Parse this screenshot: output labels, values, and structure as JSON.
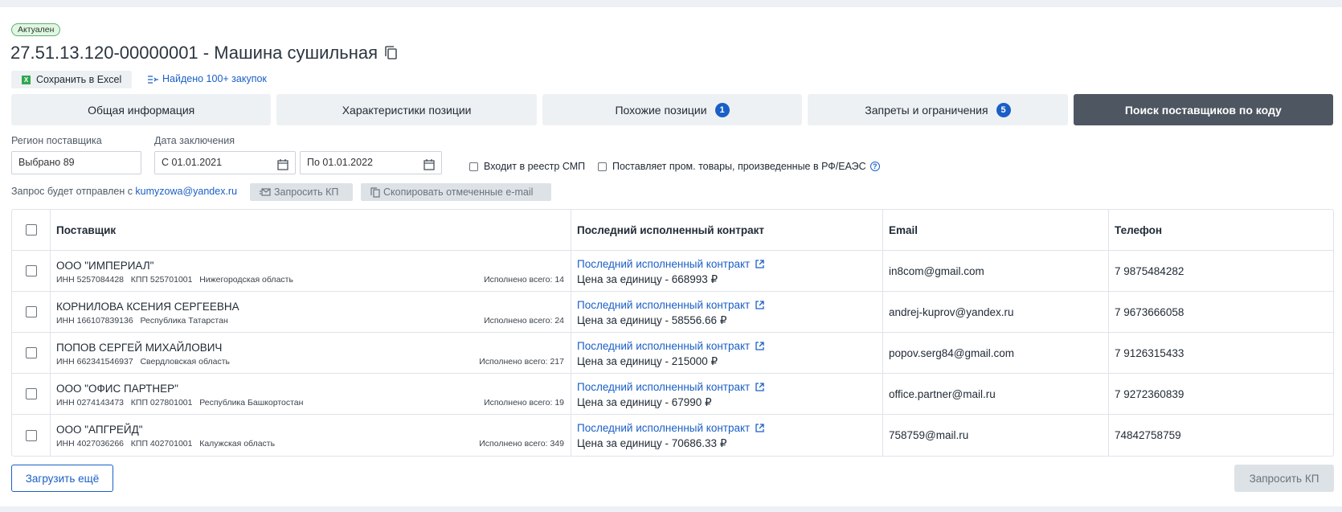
{
  "status": "Актуален",
  "title": "27.51.13.120-00000001 - Машина сушильная",
  "actions": {
    "excel": "Сохранить в Excel",
    "purchases": "Найдено 100+ закупок"
  },
  "tabs": [
    {
      "label": "Общая информация",
      "badge": ""
    },
    {
      "label": "Характеристики позиции",
      "badge": ""
    },
    {
      "label": "Похожие позиции",
      "badge": "1"
    },
    {
      "label": "Запреты и ограничения",
      "badge": "5"
    },
    {
      "label": "Поиск поставщиков по коду",
      "badge": ""
    }
  ],
  "filters": {
    "region_label": "Регион поставщика",
    "region_value": "Выбрано 89",
    "date_label": "Дата заключения",
    "date_from": "С 01.01.2021",
    "date_to": "По 01.01.2022",
    "smp_label": "Входит в реестр СМП",
    "rf_label": "Поставляет пром. товары, произведенные в РФ/ЕАЭС"
  },
  "request": {
    "note_prefix": "Запрос будет отправлен с ",
    "email": "kumyzowa@yandex.ru",
    "request_kp": "Запросить КП",
    "copy_emails": "Скопировать отмеченные e-mail"
  },
  "table": {
    "headers": [
      "Поставщик",
      "Последний исполненный контракт",
      "Email",
      "Телефон"
    ],
    "rows": [
      {
        "name": "ООО \"ИМПЕРИАЛ\"",
        "details": "ИНН 5257084428   КПП 525701001   Нижегородская область",
        "done": "Исполнено всего: 14",
        "contract": "Последний исполненный контракт",
        "price": "Цена за единицу - 668993 ₽",
        "email": "in8com@gmail.com",
        "phone": "7 9875484282"
      },
      {
        "name": "КОРНИЛОВА КСЕНИЯ СЕРГЕЕВНА",
        "details": "ИНН 166107839136   Республика Татарстан",
        "done": "Исполнено всего: 24",
        "contract": "Последний исполненный контракт",
        "price": "Цена за единицу - 58556.66 ₽",
        "email": "andrej-kuprov@yandex.ru",
        "phone": "7 9673666058"
      },
      {
        "name": "ПОПОВ СЕРГЕЙ МИХАЙЛОВИЧ",
        "details": "ИНН 662341546937   Свердловская область",
        "done": "Исполнено всего: 217",
        "contract": "Последний исполненный контракт",
        "price": "Цена за единицу - 215000 ₽",
        "email": "popov.serg84@gmail.com",
        "phone": "7 9126315433"
      },
      {
        "name": "ООО \"ОФИС ПАРТНЕР\"",
        "details": "ИНН 0274143473   КПП 027801001   Республика Башкортостан",
        "done": "Исполнено всего: 19",
        "contract": "Последний исполненный контракт",
        "price": "Цена за единицу - 67990 ₽",
        "email": "office.partner@mail.ru",
        "phone": "7 9272360839"
      },
      {
        "name": "ООО \"АПГРЕЙД\"",
        "details": "ИНН 4027036266   КПП 402701001   Калужская область",
        "done": "Исполнено всего: 349",
        "contract": "Последний исполненный контракт",
        "price": "Цена за единицу - 70686.33 ₽",
        "email": "758759@mail.ru",
        "phone": "74842758759"
      }
    ]
  },
  "footer": {
    "load_more": "Загрузить ещё",
    "request_kp": "Запросить КП"
  }
}
